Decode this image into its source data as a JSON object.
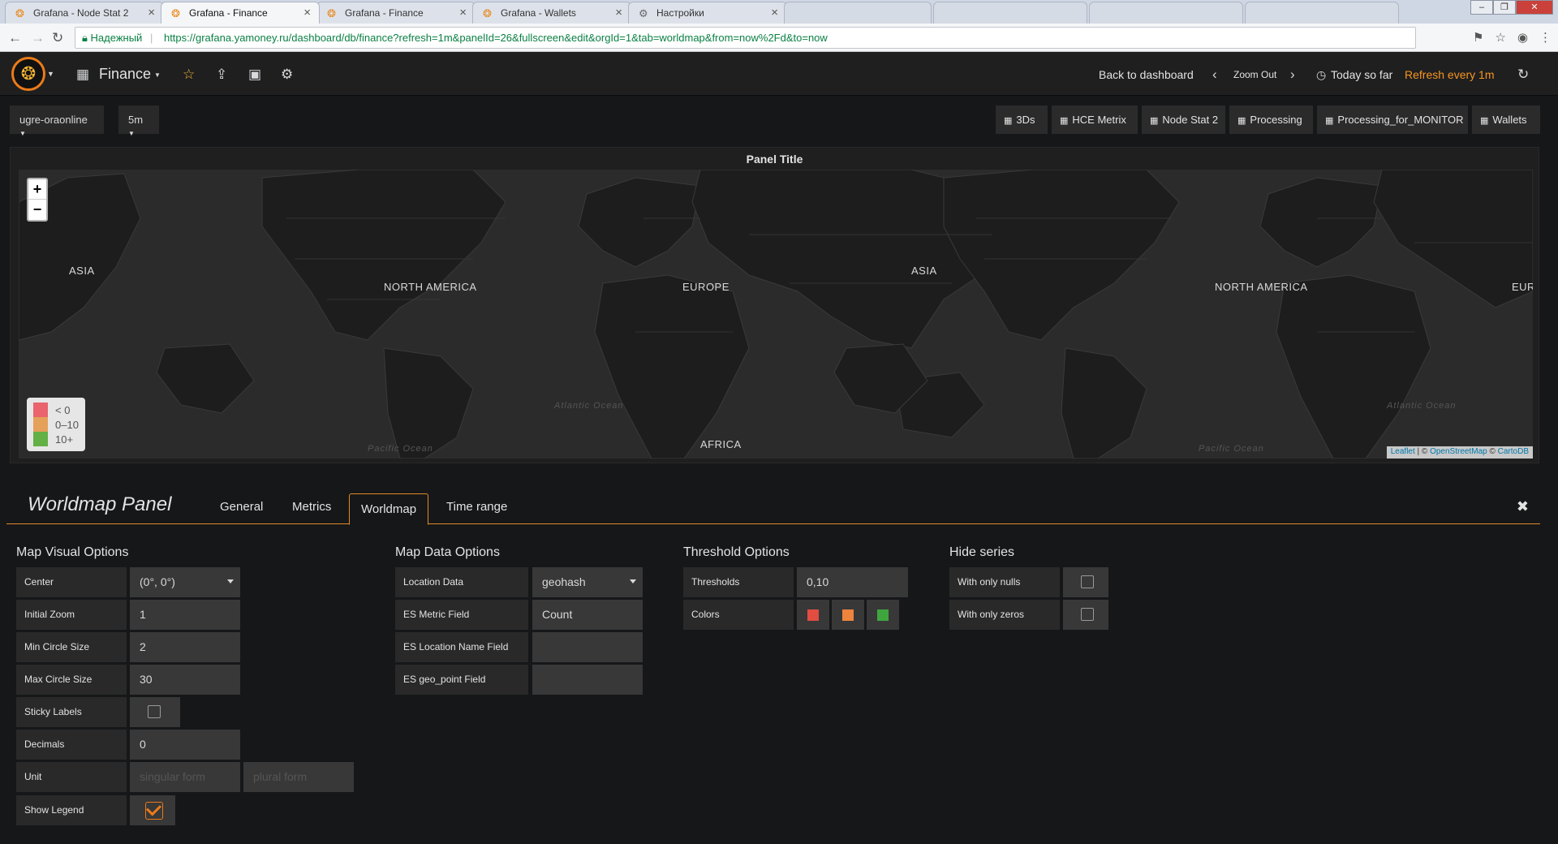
{
  "browser": {
    "tabs": [
      {
        "title": "Grafana - Node Stat 2",
        "icon": "grafana-icon"
      },
      {
        "title": "Grafana - Finance",
        "icon": "grafana-icon",
        "active": true
      },
      {
        "title": "Grafana - Finance",
        "icon": "grafana-icon"
      },
      {
        "title": "Grafana - Wallets",
        "icon": "grafana-icon"
      },
      {
        "title": "Настройки",
        "icon": "gear-icon"
      }
    ],
    "secure_label": "Надежный",
    "url_host": "https://grafana.yamoney.ru",
    "url_path": "/dashboard/db/finance?refresh=1m&panelId=26&fullscreen&edit&orgId=1&tab=worldmap&from=now%2Fd&to=now"
  },
  "nav": {
    "dashboard_name": "Finance",
    "back_label": "Back to dashboard",
    "zoom_out_label": "Zoom Out",
    "time_label": "Today so far",
    "refresh_label": "Refresh every 1m"
  },
  "variables": [
    {
      "label": "ugre-oraonline"
    },
    {
      "label": "5m"
    }
  ],
  "dash_links": [
    "3Ds",
    "HCE Metrix",
    "Node Stat 2",
    "Processing",
    "Processing_for_MONITOR",
    "Wallets"
  ],
  "panel": {
    "title": "Panel Title",
    "zoom_in": "+",
    "zoom_out": "−",
    "labels": [
      "ASIA",
      "NORTH AMERICA",
      "EUROPE",
      "ASIA",
      "NORTH AMERICA",
      "EUR",
      "AFRICA"
    ],
    "oceans": [
      "Atlantic Ocean",
      "Atlantic Ocean",
      "Pacific Ocean",
      "Pacific Ocean"
    ],
    "legend": [
      {
        "label": "< 0",
        "color": "#e9646d"
      },
      {
        "label": "0–10",
        "color": "#e5a05a"
      },
      {
        "label": "10+",
        "color": "#63b045"
      }
    ],
    "attribution": {
      "leaflet": "Leaflet",
      "sep1": " | © ",
      "osm": "OpenStreetMap",
      "sep2": " © ",
      "carto": "CartoDB"
    }
  },
  "editor": {
    "title": "Worldmap Panel",
    "tabs": [
      "General",
      "Metrics",
      "Worldmap",
      "Time range"
    ],
    "active_tab": "Worldmap",
    "map_visual": {
      "title": "Map Visual Options",
      "center_label": "Center",
      "center_value": "(0°, 0°)",
      "zoom_label": "Initial Zoom",
      "zoom_value": "1",
      "min_label": "Min Circle Size",
      "min_value": "2",
      "max_label": "Max Circle Size",
      "max_value": "30",
      "sticky_label": "Sticky Labels",
      "decimals_label": "Decimals",
      "decimals_value": "0",
      "unit_label": "Unit",
      "unit_singular_ph": "singular form",
      "unit_plural_ph": "plural form",
      "legend_label": "Show Legend"
    },
    "map_data": {
      "title": "Map Data Options",
      "location_label": "Location Data",
      "location_value": "geohash",
      "metric_label": "ES Metric Field",
      "metric_value": "Count",
      "locname_label": "ES Location Name Field",
      "geopoint_label": "ES geo_point Field"
    },
    "threshold": {
      "title": "Threshold Options",
      "thresholds_label": "Thresholds",
      "thresholds_value": "0,10",
      "colors_label": "Colors",
      "colors": [
        "#e24d42",
        "#ef843c",
        "#3fa63f"
      ]
    },
    "hide": {
      "title": "Hide series",
      "nulls_label": "With only nulls",
      "zeros_label": "With only zeros"
    }
  }
}
